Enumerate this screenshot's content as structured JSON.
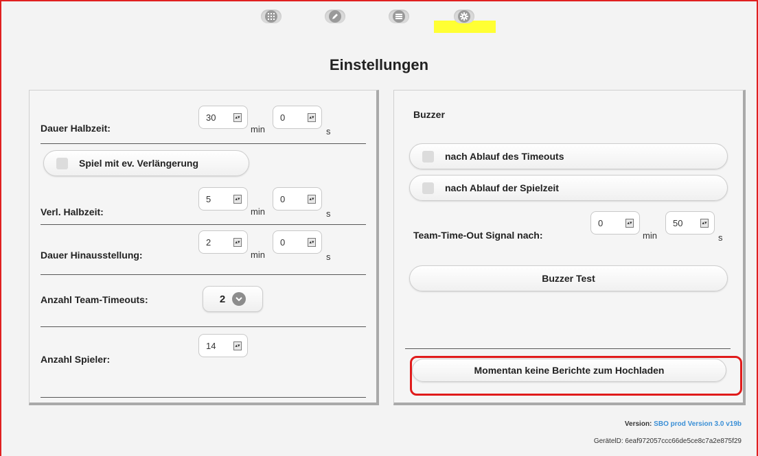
{
  "nav": {
    "items": [
      {
        "name": "grid"
      },
      {
        "name": "edit"
      },
      {
        "name": "list"
      },
      {
        "name": "settings"
      }
    ],
    "active_highlight_color": "#ffff33"
  },
  "page": {
    "title": "Einstellungen"
  },
  "left": {
    "halbzeit": {
      "label": "Dauer Halbzeit:",
      "min": "30",
      "sec": "0",
      "min_unit": "min",
      "sec_unit": "s"
    },
    "verlaengerung_toggle": {
      "label": "Spiel mit ev. Verlängerung",
      "checked": false
    },
    "verl_halbzeit": {
      "label": "Verl. Halbzeit:",
      "min": "5",
      "sec": "0",
      "min_unit": "min",
      "sec_unit": "s"
    },
    "hinausstellung": {
      "label": "Dauer Hinausstellung:",
      "min": "2",
      "sec": "0",
      "min_unit": "min",
      "sec_unit": "s"
    },
    "team_timeouts": {
      "label": "Anzahl Team-Timeouts:",
      "value": "2"
    },
    "spieler": {
      "label": "Anzahl Spieler:",
      "value": "14"
    }
  },
  "right": {
    "buzzer_heading": "Buzzer",
    "after_timeout": {
      "label": "nach Ablauf des Timeouts",
      "checked": false
    },
    "after_playtime": {
      "label": "nach Ablauf der Spielzeit",
      "checked": false
    },
    "team_timeout_signal": {
      "label": "Team-Time-Out Signal nach:",
      "min": "0",
      "sec": "50",
      "min_unit": "min",
      "sec_unit": "s"
    },
    "buzzer_test_label": "Buzzer Test",
    "upload_label": "Momentan keine Berichte zum Hochladen"
  },
  "footer": {
    "version_label": "Version:",
    "version_value": "SBO prod Version 3.0 v19b",
    "device_label": "GerätelD:",
    "device_value": "6eaf972057ccc66de5ce8c7a2e875f29"
  },
  "colors": {
    "accent_link": "#3a8fd6",
    "annotation_red": "#e02020"
  }
}
